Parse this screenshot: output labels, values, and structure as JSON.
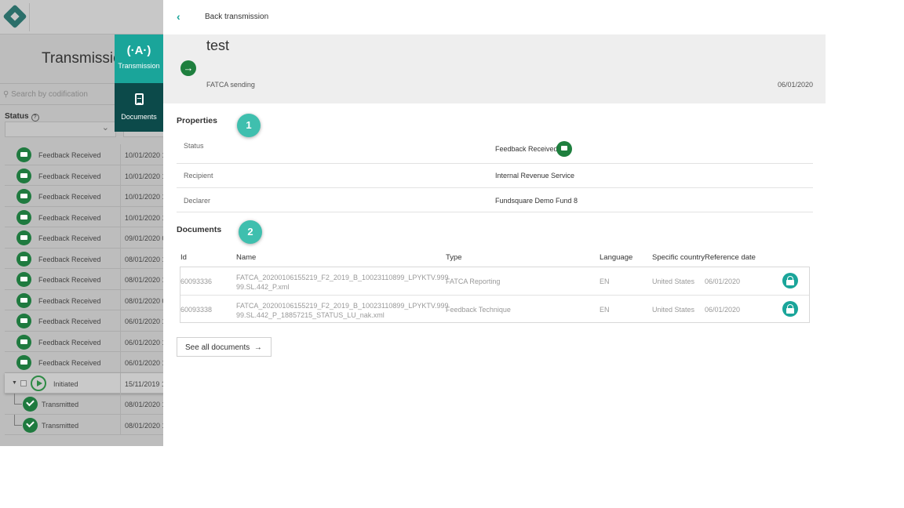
{
  "background_app": {
    "title": "Transmissio",
    "search_placeholder": "Search by codification",
    "status_label": "Status",
    "rows": [
      {
        "status": "Feedback Received",
        "date": "10/01/2020 1"
      },
      {
        "status": "Feedback Received",
        "date": "10/01/2020 1"
      },
      {
        "status": "Feedback Received",
        "date": "10/01/2020 1"
      },
      {
        "status": "Feedback Received",
        "date": "10/01/2020 1"
      },
      {
        "status": "Feedback Received",
        "date": "09/01/2020 0"
      },
      {
        "status": "Feedback Received",
        "date": "08/01/2020 1"
      },
      {
        "status": "Feedback Received",
        "date": "08/01/2020 1"
      },
      {
        "status": "Feedback Received",
        "date": "08/01/2020 0"
      },
      {
        "status": "Feedback Received",
        "date": "06/01/2020 1"
      },
      {
        "status": "Feedback Received",
        "date": "06/01/2020 1"
      },
      {
        "status": "Feedback Received",
        "date": "06/01/2020 1"
      }
    ],
    "initiated_row": {
      "status": "Initiated",
      "date": "15/11/2019 1"
    },
    "sub_rows": [
      {
        "status": "Transmitted",
        "date": "08/01/2020 1"
      },
      {
        "status": "Transmitted",
        "date": "08/01/2020 1"
      }
    ]
  },
  "side_menu": {
    "transmission": {
      "label": "Transmission",
      "icon": "antenna-icon"
    },
    "documents": {
      "label": "Documents",
      "icon": "document-icon"
    }
  },
  "panel": {
    "back_label": "Back transmission",
    "title": "test",
    "subtitle": "FATCA sending",
    "date": "06/01/2020",
    "properties": {
      "title": "Properties",
      "badge": "1",
      "rows": [
        {
          "key": "Status",
          "value": "Feedback Received"
        },
        {
          "key": "Recipient",
          "value": "Internal Revenue Service"
        },
        {
          "key": "Declarer",
          "value": "Fundsquare Demo Fund 8"
        }
      ]
    },
    "documents": {
      "title": "Documents",
      "badge": "2",
      "columns": [
        "Id",
        "Name",
        "Type",
        "Language",
        "Specific country",
        "Reference date"
      ],
      "rows": [
        {
          "id": "60093336",
          "name_line1": "FATCA_20200106155219_F2_2019_B_10023110899_LPYKTV.999",
          "name_line2": "99.SL.442_P.xml",
          "type": "FATCA Reporting",
          "language": "EN",
          "country": "United States",
          "date": "06/01/2020"
        },
        {
          "id": "60093338",
          "name_line1": "FATCA_20200106155219_F2_2019_B_10023110899_LPYKTV.999",
          "name_line2": "99.SL.442_P_18857215_STATUS_LU_nak.xml",
          "type": "Feedback Technique",
          "language": "EN",
          "country": "United States",
          "date": "06/01/2020"
        }
      ],
      "see_all": "See all documents"
    }
  },
  "colors": {
    "accent": "#1aa59a",
    "dark_accent": "#0c4a4a",
    "status_green": "#1e7f3e",
    "badge": "#3fbfae"
  }
}
